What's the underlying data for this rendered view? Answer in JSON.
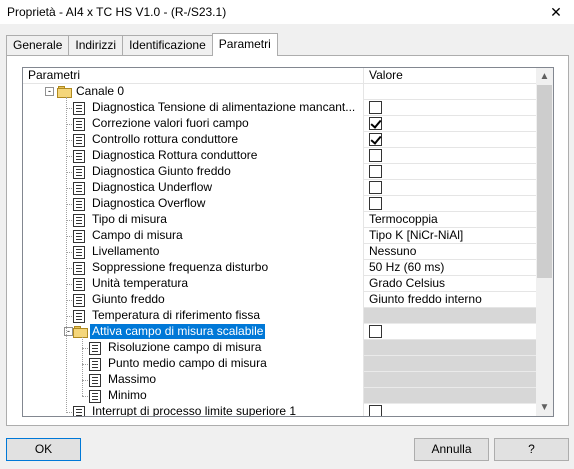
{
  "window": {
    "title": "Proprietà - AI4 x TC HS V1.0 - (R-/S23.1)"
  },
  "tabs": [
    "Generale",
    "Indirizzi",
    "Identificazione",
    "Parametri"
  ],
  "active_tab": "Parametri",
  "grid": {
    "col_param": "Parametri",
    "col_value": "Valore",
    "rows": [
      {
        "label": "Canale 0",
        "type": "group",
        "value": ""
      },
      {
        "label": "Diagnostica Tensione di alimentazione mancant...",
        "type": "item",
        "value": "",
        "check": false
      },
      {
        "label": "Correzione valori fuori campo",
        "type": "item",
        "value": "",
        "check": true
      },
      {
        "label": "Controllo rottura conduttore",
        "type": "item",
        "value": "",
        "check": true
      },
      {
        "label": "Diagnostica Rottura conduttore",
        "type": "item",
        "value": "",
        "check": false
      },
      {
        "label": "Diagnostica Giunto freddo",
        "type": "item",
        "value": "",
        "check": false
      },
      {
        "label": "Diagnostica Underflow",
        "type": "item",
        "value": "",
        "check": false
      },
      {
        "label": "Diagnostica Overflow",
        "type": "item",
        "value": "",
        "check": false
      },
      {
        "label": "Tipo di misura",
        "type": "item",
        "value": "Termocoppia"
      },
      {
        "label": "Campo di misura",
        "type": "item",
        "value": "Tipo K [NiCr-NiAl]"
      },
      {
        "label": "Livellamento",
        "type": "item",
        "value": "Nessuno"
      },
      {
        "label": "Soppressione frequenza disturbo",
        "type": "item",
        "value": "50 Hz (60 ms)"
      },
      {
        "label": "Unità temperatura",
        "type": "item",
        "value": "Grado Celsius"
      },
      {
        "label": "Giunto freddo",
        "type": "item",
        "value": "Giunto freddo interno"
      },
      {
        "label": "Temperatura di riferimento fissa",
        "type": "item",
        "value": "",
        "gray": true
      },
      {
        "label": "Attiva campo di misura scalabile",
        "type": "subgroup",
        "value": "",
        "check": false,
        "selected": true
      },
      {
        "label": "Risoluzione campo di misura",
        "type": "subitem",
        "value": "",
        "gray": true
      },
      {
        "label": "Punto medio campo di misura",
        "type": "subitem",
        "value": "",
        "gray": true
      },
      {
        "label": "Massimo",
        "type": "subitem",
        "value": "",
        "gray": true
      },
      {
        "label": "Minimo",
        "type": "subitem",
        "value": "",
        "gray": true
      },
      {
        "label": "Interrupt di processo limite superiore 1",
        "type": "item",
        "value": "",
        "check": false
      }
    ]
  },
  "buttons": {
    "ok": "OK",
    "cancel": "Annulla",
    "help": "?"
  },
  "scroll": {
    "up": "▲",
    "down": "▼"
  },
  "close_glyph": "✕"
}
